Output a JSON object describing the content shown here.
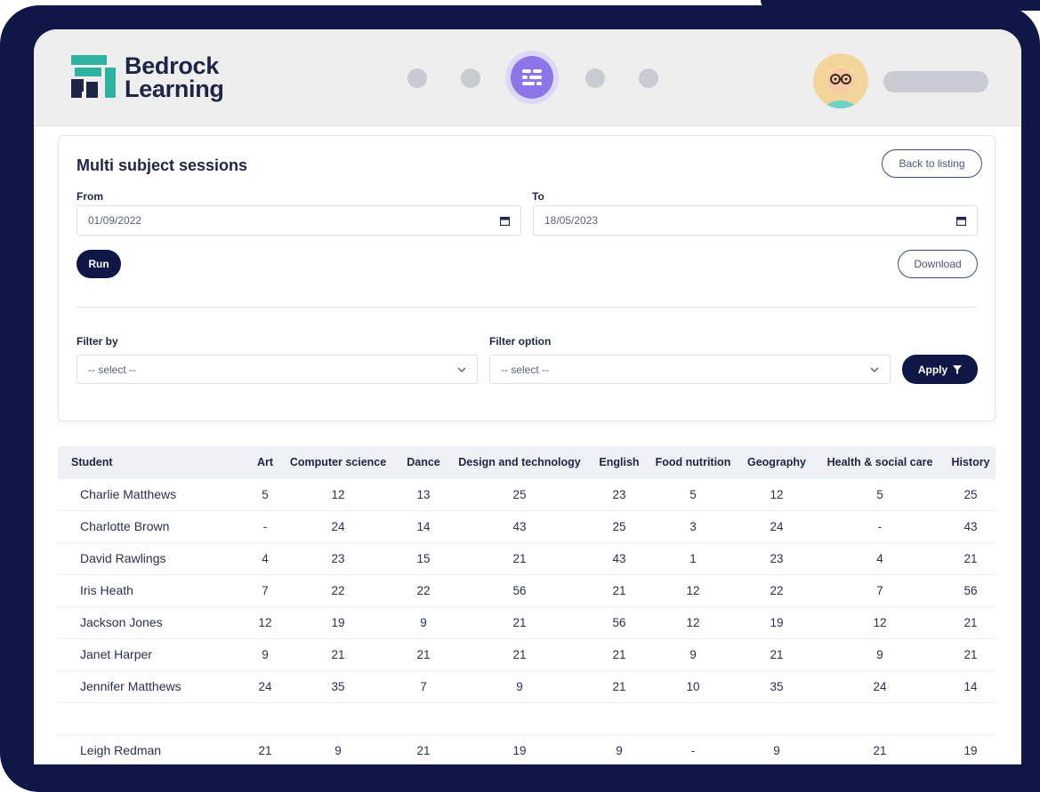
{
  "brand": {
    "line1": "Bedrock",
    "line2": "Learning",
    "color_dark": "#1e2545",
    "color_accent": "#2fb3a1"
  },
  "nav": {
    "menu_icon": "menu-lines-icon",
    "accent": "#8d74e8"
  },
  "page": {
    "title": "Multi subject sessions",
    "back_label": "Back to listing"
  },
  "dates": {
    "from_label": "From",
    "from_value": "01/09/2022",
    "to_label": "To",
    "to_value": "18/05/2023",
    "calendar_icon": "calendar-icon"
  },
  "actions": {
    "run_label": "Run",
    "download_label": "Download",
    "apply_label": "Apply"
  },
  "filters": {
    "filter_by_label": "Filter by",
    "filter_by_value": "-- select --",
    "filter_option_label": "Filter option",
    "filter_option_value": "-- select --"
  },
  "table": {
    "headers": [
      "Student",
      "Art",
      "Computer science",
      "Dance",
      "Design and technology",
      "English",
      "Food nutrition",
      "Geography",
      "Health & social care",
      "History"
    ],
    "rows": [
      [
        "Charlie Matthews",
        "5",
        "12",
        "13",
        "25",
        "23",
        "5",
        "12",
        "5",
        "25"
      ],
      [
        "Charlotte Brown",
        "-",
        "24",
        "14",
        "43",
        "25",
        "3",
        "24",
        "-",
        "43"
      ],
      [
        "David Rawlings",
        "4",
        "23",
        "15",
        "21",
        "43",
        "1",
        "23",
        "4",
        "21"
      ],
      [
        "Iris Heath",
        "7",
        "22",
        "22",
        "56",
        "21",
        "12",
        "22",
        "7",
        "56"
      ],
      [
        "Jackson Jones",
        "12",
        "19",
        "9",
        "21",
        "56",
        "12",
        "19",
        "12",
        "21"
      ],
      [
        "Janet Harper",
        "9",
        "21",
        "21",
        "21",
        "21",
        "9",
        "21",
        "9",
        "21"
      ],
      [
        "Jennifer Matthews",
        "24",
        "35",
        "7",
        "9",
        "21",
        "10",
        "35",
        "24",
        "14"
      ],
      [
        "",
        "",
        "",
        "",
        "",
        "",
        "",
        "",
        "",
        ""
      ],
      [
        "Leigh Redman",
        "21",
        "9",
        "21",
        "19",
        "9",
        "-",
        "9",
        "21",
        "19"
      ]
    ]
  }
}
